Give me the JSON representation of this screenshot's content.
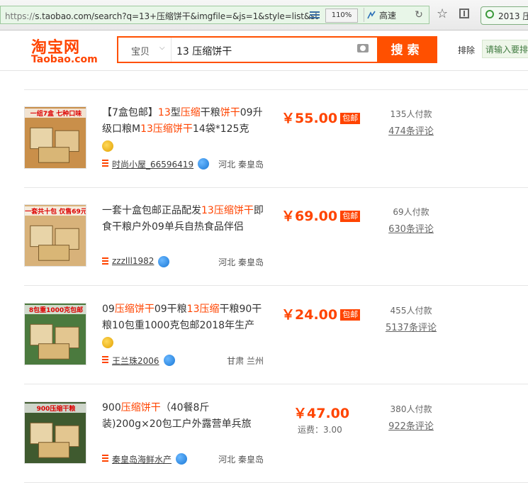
{
  "browser": {
    "url_protocol": "https://",
    "url_rest": "s.taobao.com/search?q=13+压缩饼干&imgfile=&js=1&style=list&st",
    "zoom": "110%",
    "speed_label": "高速",
    "search_pill_text": "2013 压"
  },
  "header": {
    "logo_cn": "淘宝网",
    "logo_en": "Taobao.com",
    "category": "宝贝",
    "query": "13 压缩饼干",
    "search_button": "搜索",
    "exclude_label": "排除",
    "exclude_placeholder": "请输入要排"
  },
  "peek": {
    "seller": "时尚小屋_66596419   河北 秦皇岛"
  },
  "items": [
    {
      "title_parts": [
        {
          "t": "【7盒包邮】",
          "hl": false
        },
        {
          "t": "13",
          "hl": true
        },
        {
          "t": "型",
          "hl": false
        },
        {
          "t": "压缩",
          "hl": true
        },
        {
          "t": "干粮",
          "hl": false
        },
        {
          "t": "饼干",
          "hl": true
        },
        {
          "t": "09升级口粮M",
          "hl": false
        },
        {
          "t": "13",
          "hl": true
        },
        {
          "t": "压缩饼干",
          "hl": true
        },
        {
          "t": "14袋*125克",
          "hl": false
        }
      ],
      "medal": true,
      "thumb_banner": "一组7盒 七种口味",
      "price": "￥55.00",
      "badge": "包邮",
      "shipping": "",
      "sales": "135人付款",
      "reviews": "474条评论",
      "seller": "时尚小屋_66596419",
      "location": "河北 秦皇岛"
    },
    {
      "title_parts": [
        {
          "t": "一套十盒包邮正品配发",
          "hl": false
        },
        {
          "t": "13",
          "hl": true
        },
        {
          "t": "压缩饼干",
          "hl": true
        },
        {
          "t": "即食干粮户外09单兵自热食品伴侣",
          "hl": false
        }
      ],
      "medal": false,
      "thumb_banner": "一套共十包 仅售69元",
      "price": "￥69.00",
      "badge": "包邮",
      "shipping": "",
      "sales": "69人付款",
      "reviews": "630条评论",
      "seller": "zzzlll1982",
      "location": "河北 秦皇岛"
    },
    {
      "title_parts": [
        {
          "t": "09",
          "hl": false
        },
        {
          "t": "压缩饼干",
          "hl": true
        },
        {
          "t": "09干粮",
          "hl": false
        },
        {
          "t": "13",
          "hl": true
        },
        {
          "t": "压缩",
          "hl": true
        },
        {
          "t": "干粮90干粮10包重1000克包邮2018年生产",
          "hl": false
        }
      ],
      "medal": true,
      "thumb_banner": "8包重1000克包邮",
      "price": "￥24.00",
      "badge": "包邮",
      "shipping": "",
      "sales": "455人付款",
      "reviews": "5137条评论",
      "seller": "王兰珠2006",
      "location": "甘肃 兰州"
    },
    {
      "title_parts": [
        {
          "t": "900",
          "hl": false
        },
        {
          "t": "压缩饼干",
          "hl": true
        },
        {
          "t": "（40餐8斤装)200g×20包工户外露营单兵旅",
          "hl": false
        }
      ],
      "medal": false,
      "thumb_banner": "900压缩干粮",
      "price": "￥47.00",
      "badge": "",
      "shipping": "运费：3.00",
      "sales": "380人付款",
      "reviews": "922条评论",
      "seller": "秦皇岛海鲜水产",
      "location": "河北 秦皇岛"
    }
  ],
  "colors": {
    "brand_orange": "#ff4400",
    "search_orange": "#ff5000",
    "url_green": "#e8f6e8"
  }
}
